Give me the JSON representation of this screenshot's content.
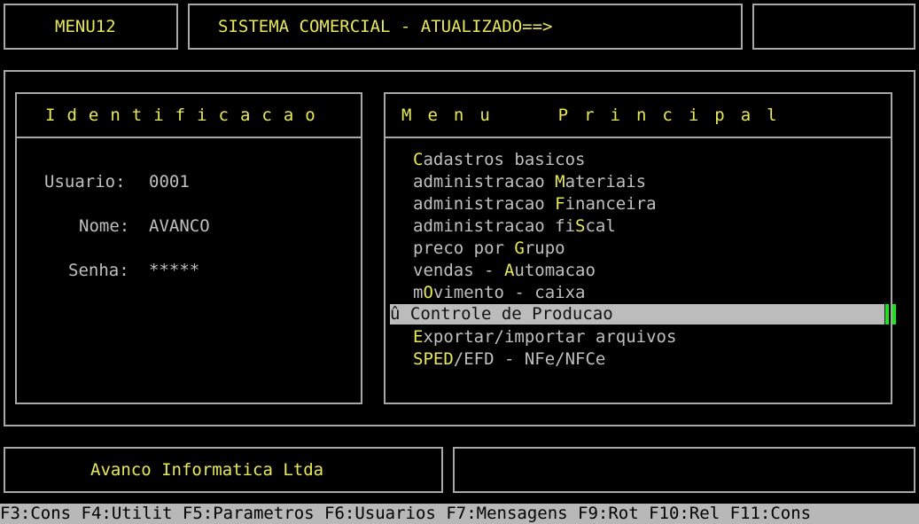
{
  "top": {
    "menu_code": "MENU12",
    "title": "SISTEMA COMERCIAL - ATUALIZADO==>",
    "right_box": ""
  },
  "ident": {
    "header": "Identificacao",
    "usuario_label": "Usuario:",
    "usuario_value": "0001",
    "nome_label": "Nome:",
    "nome_value": "AVANCO",
    "senha_label": "Senha:",
    "senha_value": "*****"
  },
  "menu": {
    "header": "Menu  Principal",
    "selected_marker": "û",
    "items": [
      {
        "pre": "",
        "key": "C",
        "post": "adastros basicos"
      },
      {
        "pre": "administracao ",
        "key": "M",
        "post": "ateriais"
      },
      {
        "pre": "administracao ",
        "key": "F",
        "post": "inanceira"
      },
      {
        "pre": "administracao fi",
        "key": "S",
        "post": "cal"
      },
      {
        "pre": "preco por ",
        "key": "G",
        "post": "rupo"
      },
      {
        "pre": "vendas - ",
        "key": "A",
        "post": "utomacao"
      },
      {
        "pre": "m",
        "key": "O",
        "post": "vimento - caixa"
      },
      {
        "pre": "",
        "key": "",
        "post": "Controle de Producao"
      },
      {
        "pre": "",
        "key": "E",
        "post": "xportar/importar arquivos"
      },
      {
        "pre": "",
        "key": "SPED",
        "post": "/EFD - NFe/NFCe"
      }
    ]
  },
  "footer": {
    "company": "Avanco Informatica Ltda",
    "right_box": ""
  },
  "statusbar": "F3:Cons F4:Utilit F5:Parametros F6:Usuarios F7:Mensagens F9:Rot F10:Rel F11:Cons",
  "colors": {
    "text_yellow": "#e8e85a",
    "highlight_bg": "#bcbcbc",
    "cursor": "#19e619"
  }
}
